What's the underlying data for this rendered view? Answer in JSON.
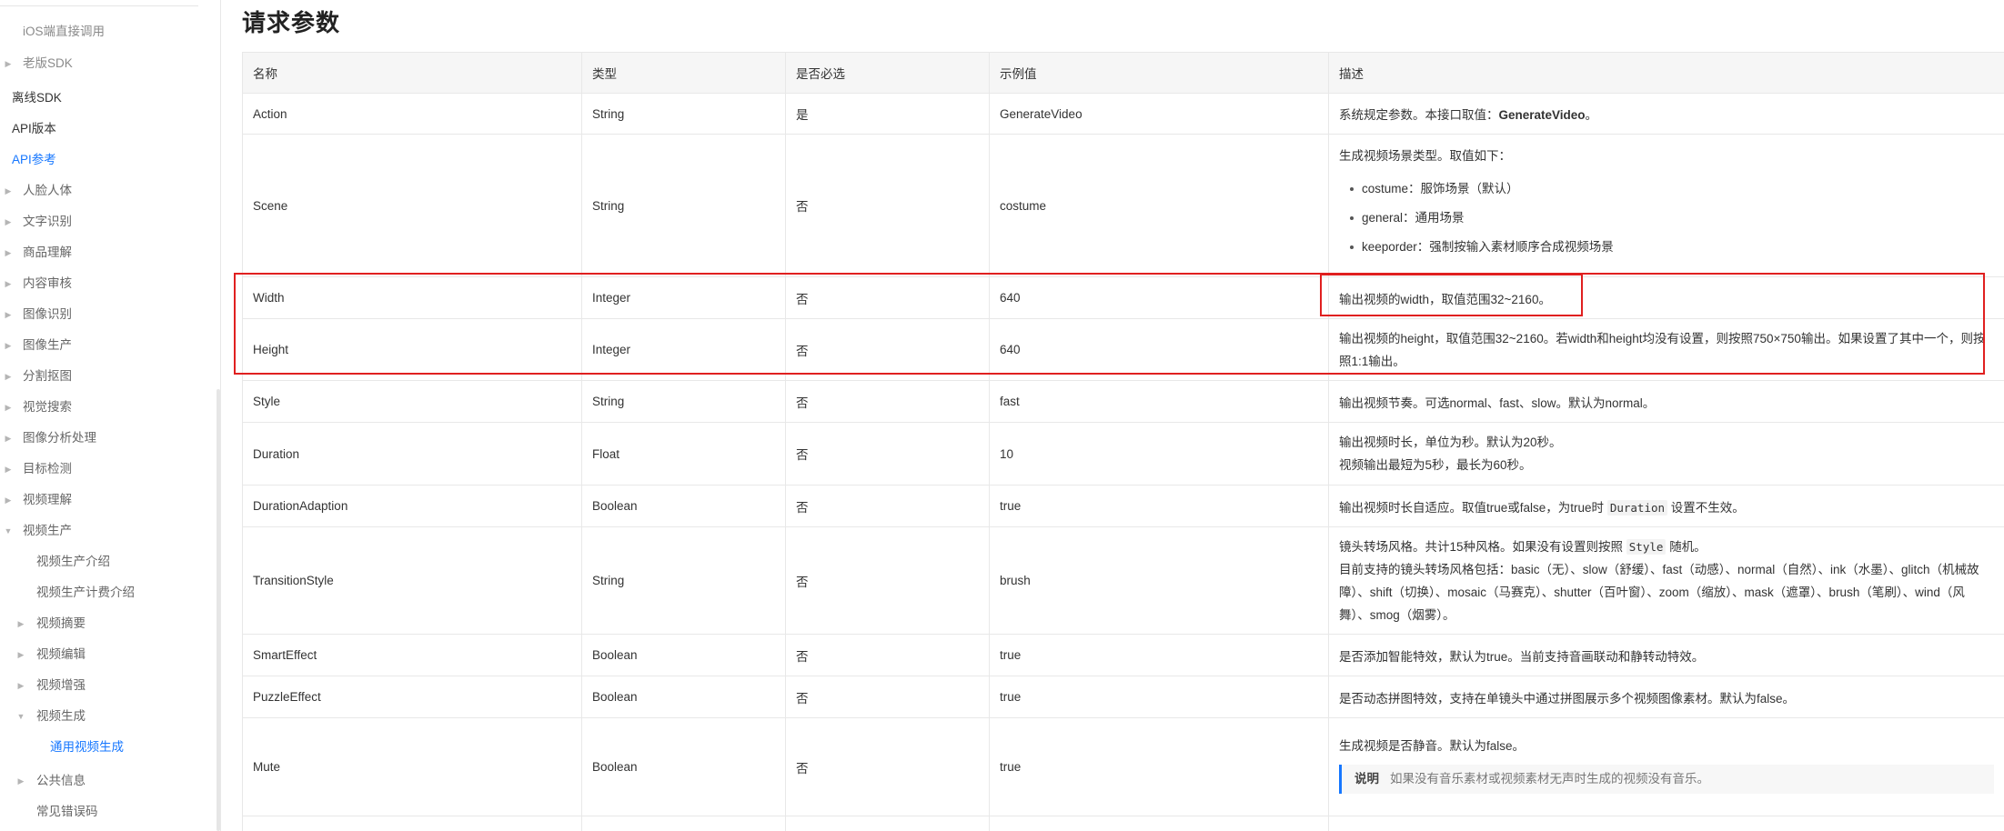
{
  "sidebar": {
    "items": [
      {
        "label": "iOS端直接调用",
        "caret": "",
        "style": "muted"
      },
      {
        "label": "老版SDK",
        "caret": "▶",
        "style": "muted"
      },
      {
        "label": "离线SDK",
        "caret": "",
        "style": "level0"
      },
      {
        "label": "API版本",
        "caret": "",
        "style": "level0"
      },
      {
        "label": "API参考",
        "caret": "",
        "style": "active"
      },
      {
        "label": "人脸人体",
        "caret": "▶",
        "style": ""
      },
      {
        "label": "文字识别",
        "caret": "▶",
        "style": ""
      },
      {
        "label": "商品理解",
        "caret": "▶",
        "style": ""
      },
      {
        "label": "内容审核",
        "caret": "▶",
        "style": ""
      },
      {
        "label": "图像识别",
        "caret": "▶",
        "style": ""
      },
      {
        "label": "图像生产",
        "caret": "▶",
        "style": ""
      },
      {
        "label": "分割抠图",
        "caret": "▶",
        "style": ""
      },
      {
        "label": "视觉搜索",
        "caret": "▶",
        "style": ""
      },
      {
        "label": "图像分析处理",
        "caret": "▶",
        "style": ""
      },
      {
        "label": "目标检测",
        "caret": "▶",
        "style": ""
      },
      {
        "label": "视频理解",
        "caret": "▶",
        "style": ""
      },
      {
        "label": "视频生产",
        "caret": "▼",
        "style": ""
      },
      {
        "label": "视频生产介绍",
        "caret": "",
        "style": ""
      },
      {
        "label": "视频生产计费介绍",
        "caret": "",
        "style": ""
      },
      {
        "label": "视频摘要",
        "caret": "▶",
        "style": ""
      },
      {
        "label": "视频编辑",
        "caret": "▶",
        "style": ""
      },
      {
        "label": "视频增强",
        "caret": "▶",
        "style": ""
      },
      {
        "label": "视频生成",
        "caret": "▼",
        "style": ""
      },
      {
        "label": "通用视频生成",
        "caret": "",
        "style": "active"
      },
      {
        "label": "公共信息",
        "caret": "▶",
        "style": ""
      },
      {
        "label": "常见错误码",
        "caret": "",
        "style": ""
      }
    ]
  },
  "page": {
    "title": "请求参数"
  },
  "table": {
    "headers": [
      "名称",
      "类型",
      "是否必选",
      "示例值",
      "描述"
    ],
    "rows": [
      {
        "name": "Action",
        "type": "String",
        "required": "是",
        "example": "GenerateVideo",
        "desc": "系统规定参数。本接口取值：",
        "desc_bold": "GenerateVideo",
        "desc_end": "。"
      },
      {
        "name": "Scene",
        "type": "String",
        "required": "否",
        "example": "costume",
        "desc": "生成视频场景类型。取值如下：",
        "list": [
          "costume：服饰场景（默认）",
          "general：通用场景",
          "keeporder：强制按输入素材顺序合成视频场景"
        ]
      },
      {
        "name": "Width",
        "type": "Integer",
        "required": "否",
        "example": "640",
        "desc": "输出视频的width，取值范围32~2160。"
      },
      {
        "name": "Height",
        "type": "Integer",
        "required": "否",
        "example": "640",
        "desc": "输出视频的height，取值范围32~2160。若width和height均没有设置，则按照750×750输出。如果设置了其中一个，则按照1:1输出。"
      },
      {
        "name": "Style",
        "type": "String",
        "required": "否",
        "example": "fast",
        "desc": "输出视频节奏。可选normal、fast、slow。默认为normal。"
      },
      {
        "name": "Duration",
        "type": "Float",
        "required": "否",
        "example": "10",
        "desc": "输出视频时长，单位为秒。默认为20秒。",
        "desc2": "视频输出最短为5秒，最长为60秒。"
      },
      {
        "name": "DurationAdaption",
        "type": "Boolean",
        "required": "否",
        "example": "true",
        "desc": "输出视频时长自适应。取值true或false，为true时",
        "desc_code": "Duration",
        "desc_end": "设置不生效。"
      },
      {
        "name": "TransitionStyle",
        "type": "String",
        "required": "否",
        "example": "brush",
        "desc": "镜头转场风格。共计15种风格。如果没有设置则按照",
        "desc_code": "Style",
        "desc_end": "随机。",
        "desc2": "目前支持的镜头转场风格包括：basic（无）、slow（舒缓）、fast（动感）、normal（自然）、ink（水墨）、glitch（机械故障）、shift（切换）、mosaic（马赛克）、shutter（百叶窗）、zoom（缩放）、mask（遮罩）、brush（笔刷）、wind（风舞）、smog（烟雾）。"
      },
      {
        "name": "SmartEffect",
        "type": "Boolean",
        "required": "否",
        "example": "true",
        "desc": "是否添加智能特效，默认为true。当前支持音画联动和静转动特效。"
      },
      {
        "name": "PuzzleEffect",
        "type": "Boolean",
        "required": "否",
        "example": "true",
        "desc": "是否动态拼图特效，支持在单镜头中通过拼图展示多个视频图像素材。默认为false。"
      },
      {
        "name": "Mute",
        "type": "Boolean",
        "required": "否",
        "example": "true",
        "desc": "生成视频是否静音。默认为false。",
        "note_title": "说明",
        "note": "如果没有音乐素材或视频素材无声时生成的视频没有音乐。"
      }
    ]
  },
  "colors": {
    "accent": "#1677ff",
    "annotation": "#e02020",
    "header_bg": "#f6f6f6"
  }
}
